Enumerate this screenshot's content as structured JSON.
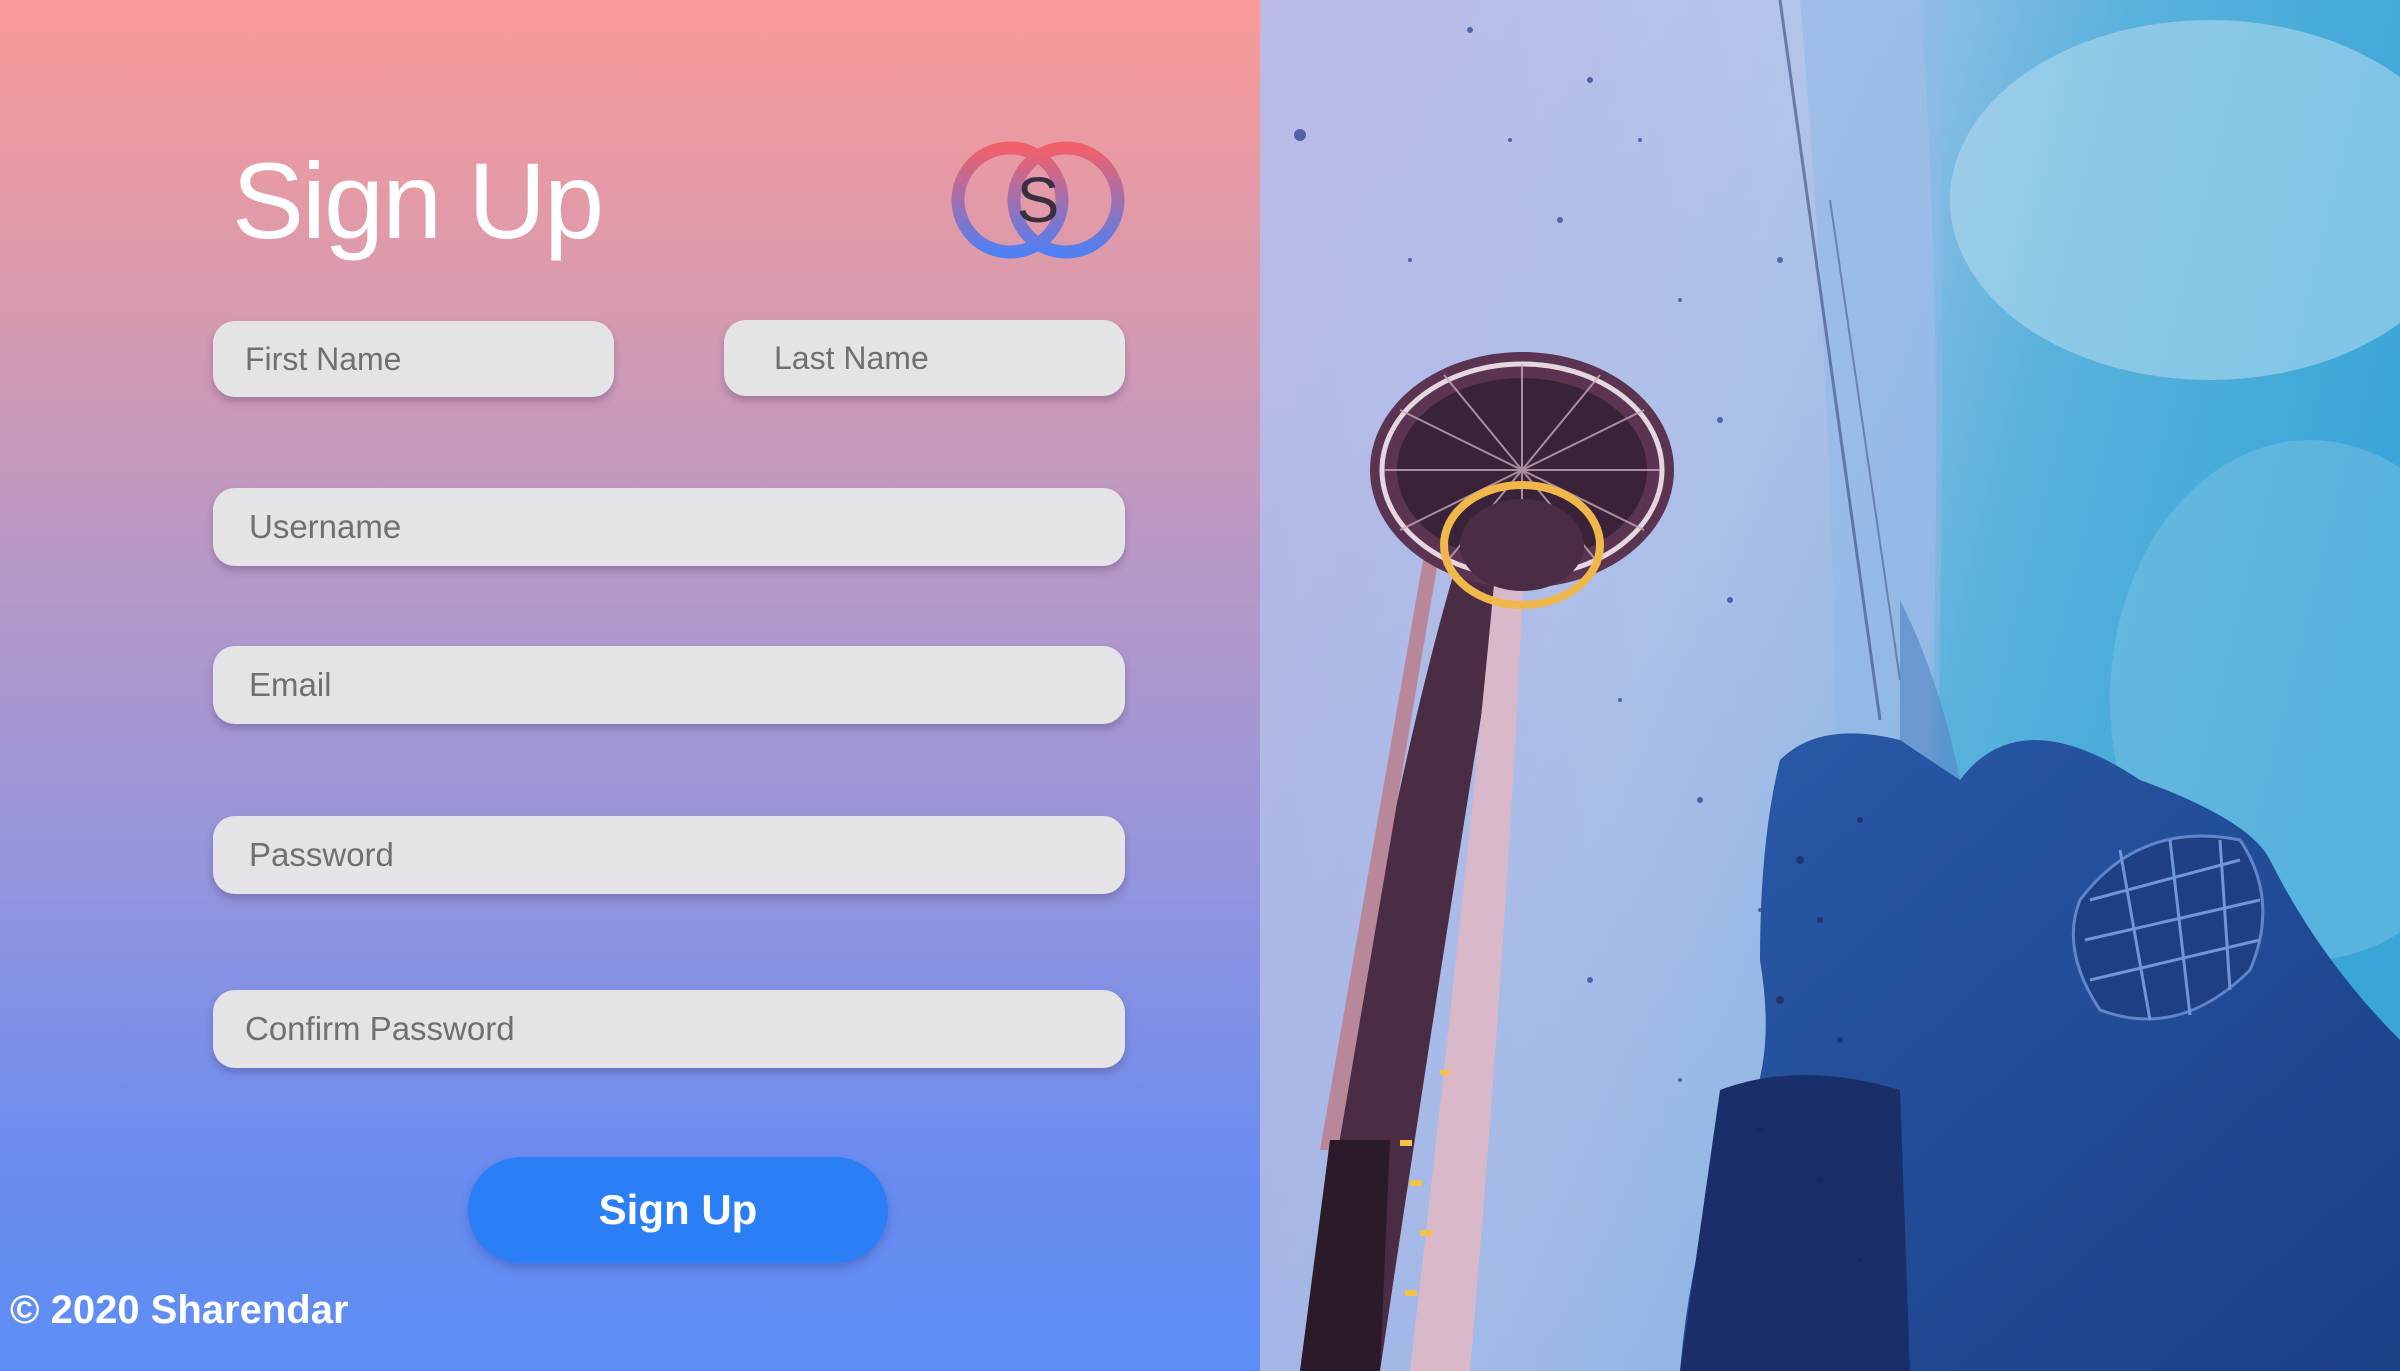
{
  "form": {
    "title": "Sign Up",
    "logo_letter": "S",
    "fields": {
      "first_name_placeholder": "First Name",
      "last_name_placeholder": "Last Name",
      "username_placeholder": "Username",
      "email_placeholder": "Email",
      "password_placeholder": "Password",
      "confirm_password_placeholder": "Confirm Password"
    },
    "submit_label": "Sign Up"
  },
  "footer": {
    "copyright": "© 2020 Sharendar"
  },
  "hero": {
    "icon": "space-needle-photo"
  },
  "colors": {
    "gradient_top": "#f99a98",
    "gradient_bottom": "#5c8ef5",
    "button": "#2a7ff6",
    "field_bg": "#e4e4e6"
  }
}
